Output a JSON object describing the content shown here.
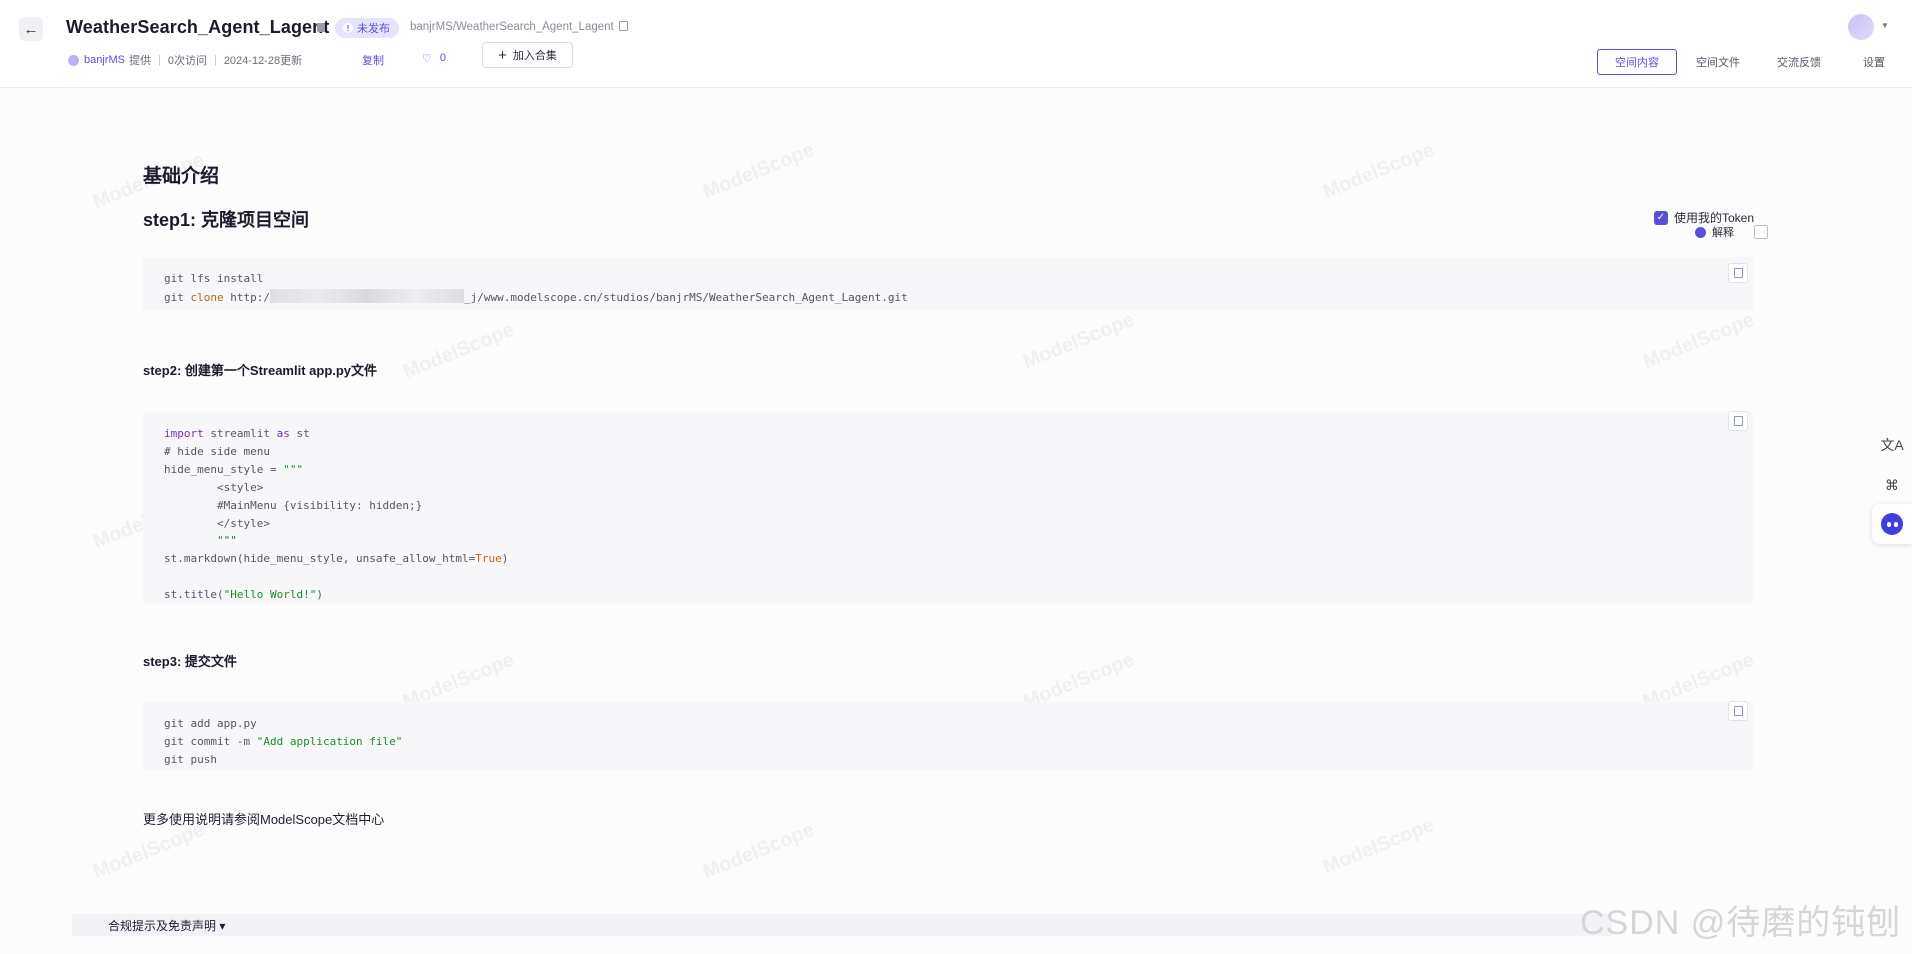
{
  "header": {
    "title": "WeatherSearch_Agent_Lagent",
    "status_badge": "未发布",
    "repo_path": "banjrMS/WeatherSearch_Agent_Lagent",
    "author": "banjrMS",
    "provided": "提供",
    "visits": "0次访问",
    "updated": "2024-12-28更新",
    "copy_label": "复制",
    "likes": "0",
    "add_collection": "加入合集",
    "tabs": [
      "空间内容",
      "空间文件",
      "交流反馈",
      "设置"
    ]
  },
  "content": {
    "heading": "基础介绍",
    "step1_title": "step1: 克隆项目空间",
    "use_token_label": "使用我的Token",
    "explain_label": "解释",
    "step1_code": {
      "line1": "git lfs install",
      "line2_cmd": "git",
      "line2_sub": "clone",
      "line2_pre": "http:/",
      "line2_post": "_j/www.modelscope.cn/studios/banjrMS/WeatherSearch_Agent_Lagent.git"
    },
    "step2_title": "step2: 创建第一个Streamlit app.py文件",
    "step2_code": {
      "import_kw": "import",
      "import_mod": " streamlit ",
      "as_kw": "as",
      "import_alias": " st",
      "comment": "# hide side menu",
      "assign": "hide_menu_style = ",
      "triple_open": "\"\"\"",
      "style_open": "        <style>",
      "main_menu": "        #MainMenu {visibility: hidden;}",
      "style_close": "        </style>",
      "triple_close": "        \"\"\"",
      "markdown_pre": "st.markdown(hide_menu_style, unsafe_allow_html=",
      "markdown_true": "True",
      "markdown_post": ")",
      "title_pre": "st.title(",
      "title_str": "\"Hello World!\"",
      "title_post": ")"
    },
    "step3_title": "step3: 提交文件",
    "step3_code": {
      "line1": "git add app.py",
      "line2_pre": "git commit -m ",
      "line2_str": "\"Add application file\"",
      "line3": "git push"
    },
    "footer_note": "更多使用说明请参阅ModelScope文档中心"
  },
  "disclaimer": "合规提示及免责声明 ▾",
  "side_tools": [
    "translate-icon",
    "apps-icon",
    "assistant-bot-icon"
  ],
  "watermark_text": "ModelScope",
  "csdn_watermark": "CSDN @待磨的钝刨",
  "colors": {
    "accent": "#5b4fd6",
    "code_bg": "#f7f7f9",
    "string": "#1d8c2a",
    "keyword": "#7a2fb3"
  }
}
